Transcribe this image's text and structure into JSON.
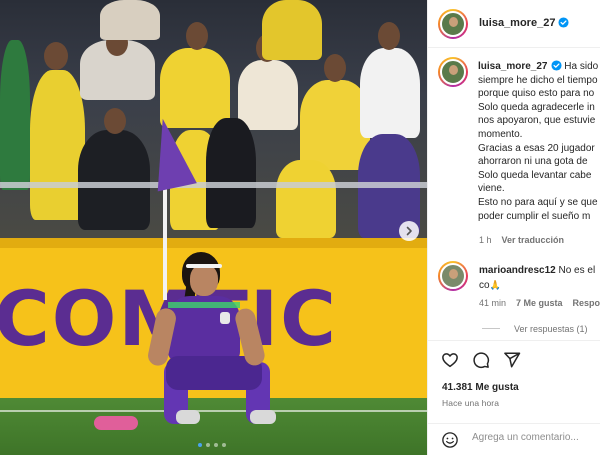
{
  "post": {
    "username": "luisa_more_27",
    "caption_lines": [
      "Ha sido",
      "siempre he dicho el tiempo",
      "porque quiso esto para no",
      "Solo queda agradecerle in",
      "nos apoyaron, que estuvie",
      "momento.",
      "Gracias a esas 20 jugador",
      "ahorraron ni una gota de",
      "Solo queda levantar cabe",
      "viene.",
      "Esto no para aquí y se que",
      "poder cumplir el sueño m"
    ],
    "caption_time": "1 h",
    "translate_label": "Ver traducción",
    "likes": "41.381 Me gusta",
    "time_ago": "Hace una hora"
  },
  "comment": {
    "username": "marioandresc12",
    "text_line1": "No es el",
    "text_line2": "co",
    "emoji": "🙏",
    "time": "41 min",
    "likes": "7 Me gusta",
    "reply_label": "Respo",
    "view_replies": "Ver respuestas (1)"
  },
  "composer": {
    "placeholder": "Agrega un comentario..."
  },
  "media": {
    "billboard_text": "COMTIC",
    "carousel": {
      "count": 4,
      "active": 1
    }
  },
  "icons": {
    "verified": "verified-badge-icon",
    "like": "heart-icon",
    "comment": "comment-bubble-icon",
    "share": "paper-plane-icon",
    "emoji": "smiley-icon",
    "next": "chevron-right-icon"
  },
  "colors": {
    "verified": "#0095f6",
    "billboard": "#f6c21a",
    "jersey": "#5a2ea0"
  }
}
